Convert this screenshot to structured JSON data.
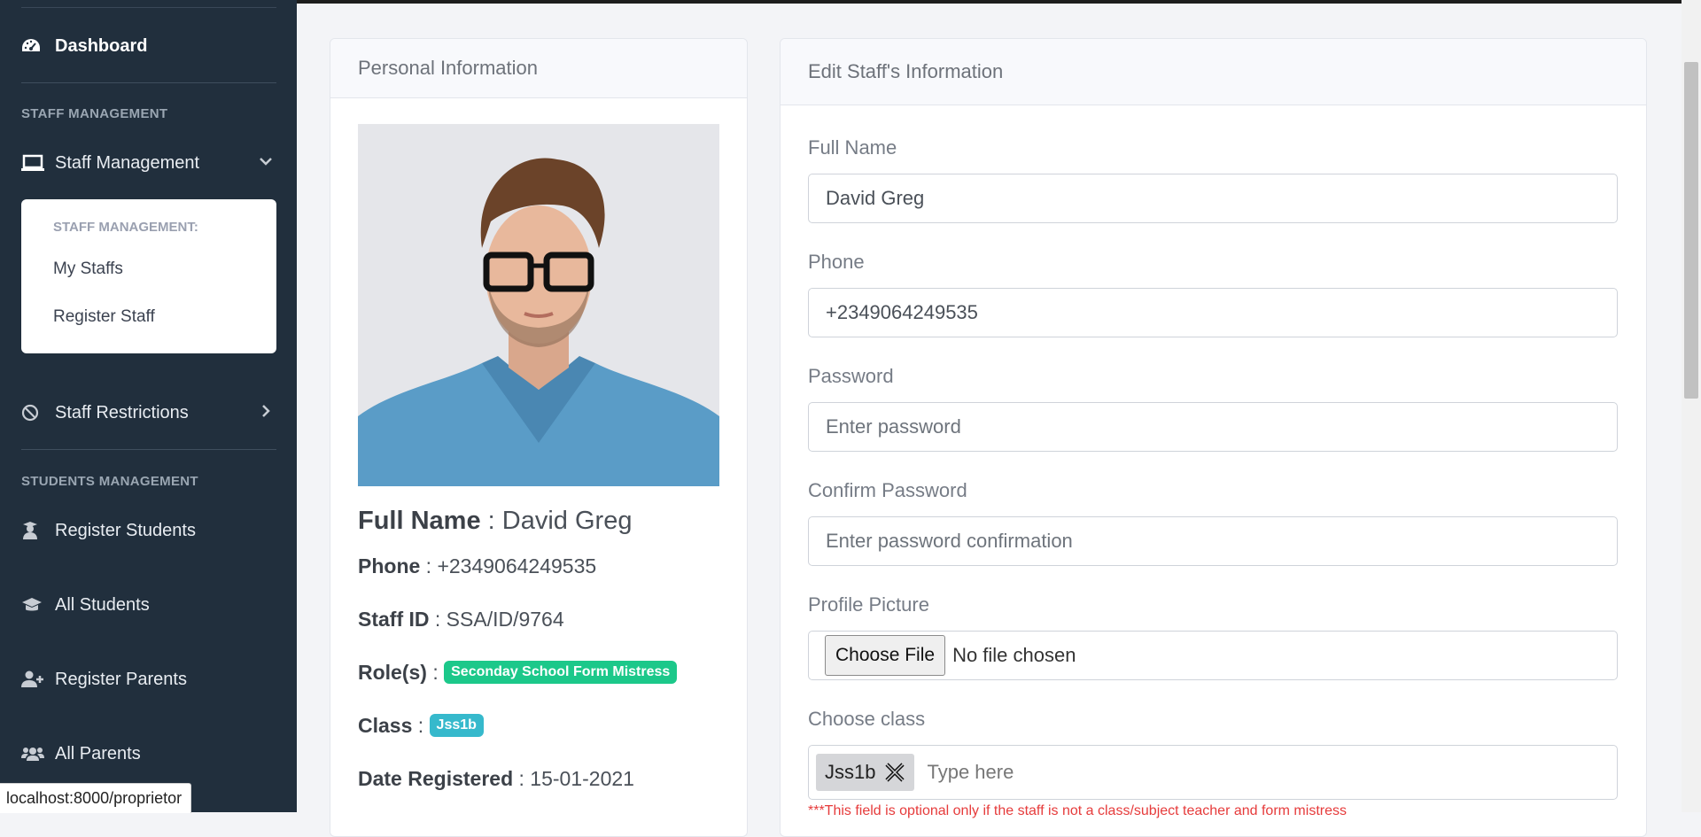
{
  "sidebar": {
    "dashboard": "Dashboard",
    "section_staff": "STAFF MANAGEMENT",
    "staff_management": "Staff Management",
    "submenu_heading": "STAFF MANAGEMENT:",
    "submenu_items": [
      "My Staffs",
      "Register Staff"
    ],
    "staff_restrictions": "Staff Restrictions",
    "section_students": "STUDENTS MANAGEMENT",
    "register_students": "Register Students",
    "all_students": "All Students",
    "register_parents": "Register Parents",
    "all_parents": "All Parents"
  },
  "personal": {
    "title": "Personal Information",
    "full_name_label": "Full Name",
    "full_name": "David Greg",
    "phone_label": "Phone",
    "phone": "+2349064249535",
    "staff_id_label": "Staff ID",
    "staff_id": "SSA/ID/9764",
    "roles_label": "Role(s)",
    "role": "Seconday School Form Mistress",
    "class_label": "Class",
    "class": "Jss1b",
    "date_label": "Date Registered",
    "date": "15-01-2021",
    "separator": ":"
  },
  "edit": {
    "title": "Edit Staff's Information",
    "full_name_label": "Full Name",
    "full_name_value": "David Greg",
    "phone_label": "Phone",
    "phone_value": "+2349064249535",
    "password_label": "Password",
    "password_placeholder": "Enter password",
    "confirm_label": "Confirm Password",
    "confirm_placeholder": "Enter password confirmation",
    "picture_label": "Profile Picture",
    "choose_file": "Choose File",
    "no_file": "No file chosen",
    "class_label": "Choose class",
    "class_tag": "Jss1b",
    "class_placeholder": "Type here",
    "note": "***This field is optional only if the staff is not a class/subject teacher and form mistress"
  },
  "status_url": "localhost:8000/proprietor",
  "colors": {
    "sidebar_bg": "#212f3d",
    "role_badge": "#1cc88a",
    "class_badge": "#36b9cc",
    "note_red": "#e63b3b"
  },
  "icons": {
    "dashboard": "tachometer-icon",
    "staff_management": "laptop-icon",
    "staff_restrictions": "ban-icon",
    "register_students": "user-graduate-icon",
    "all_students": "graduation-cap-icon",
    "register_parents": "user-plus-icon",
    "all_parents": "users-icon"
  }
}
